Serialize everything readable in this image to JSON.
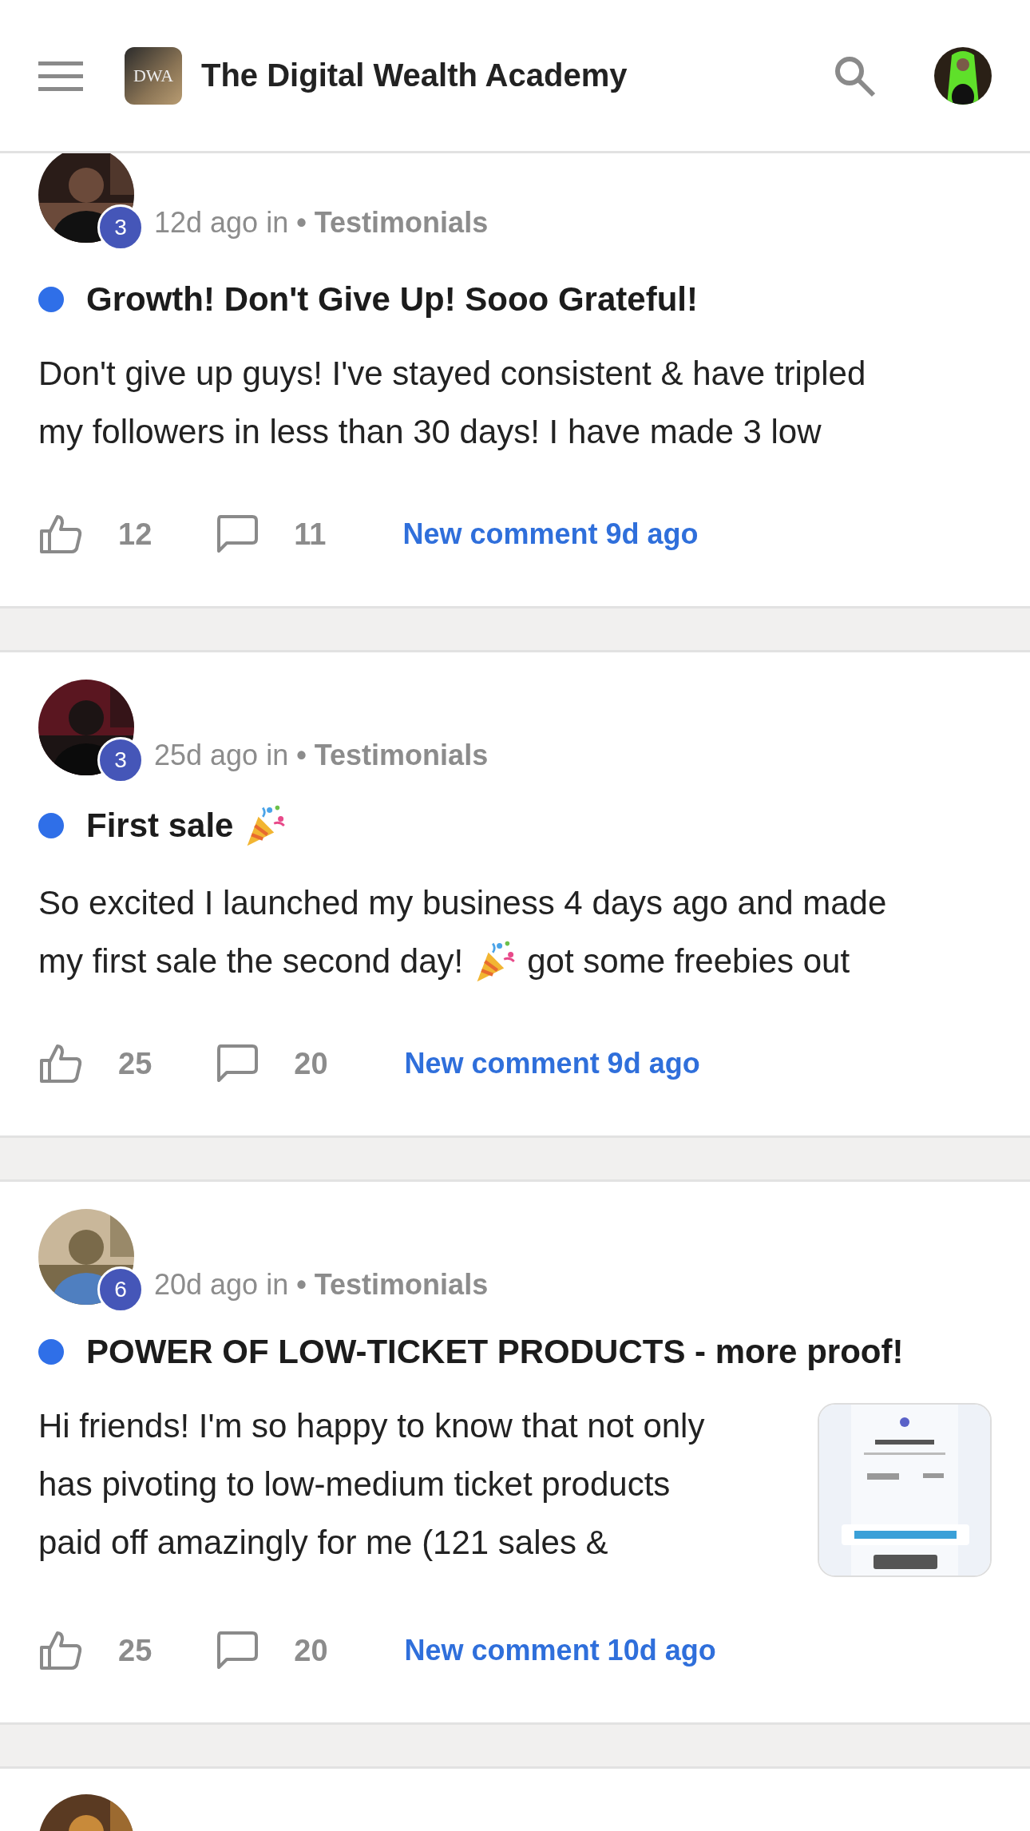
{
  "header": {
    "logo_text": "DWA",
    "title": "The Digital Wealth Academy"
  },
  "posts": [
    {
      "level": "3",
      "time": "12d ago in",
      "category": "• Testimonials",
      "unread": true,
      "title": "Growth! Don't Give Up! Sooo Grateful!",
      "lines": [
        [
          {
            "kind": "text",
            "text": "Don't give up guys! I've stayed consistent & have tripled"
          }
        ],
        [
          {
            "kind": "text",
            "text": "my followers in less than 30 days! I have made 3 low"
          }
        ]
      ],
      "likes": "12",
      "comments": "11",
      "activity": "New comment 9d ago"
    },
    {
      "level": "3",
      "time": "25d ago in",
      "category": "• Testimonials",
      "unread": true,
      "title": "First sale",
      "title_extra": {
        "kind": "emoji"
      },
      "lines": [
        [
          {
            "kind": "text",
            "text": "So excited I launched my business 4 days ago and made"
          }
        ],
        [
          {
            "kind": "text",
            "text": "my first sale the second day!"
          },
          {
            "kind": "emoji"
          },
          {
            "kind": "text",
            "text": "got some freebies out"
          }
        ]
      ],
      "likes": "25",
      "comments": "20",
      "activity": "New comment 9d ago"
    },
    {
      "level": "6",
      "time": "20d ago in",
      "category": "• Testimonials",
      "unread": true,
      "title": "POWER OF LOW-TICKET PRODUCTS - more proof!",
      "lines": [
        [
          {
            "kind": "text",
            "text": "Hi friends! I'm so happy to know that not only"
          }
        ],
        [
          {
            "kind": "text",
            "text": "has pivoting to low-medium ticket products"
          }
        ],
        [
          {
            "kind": "text",
            "text": "paid off amazingly for me (121 sales &"
          }
        ]
      ],
      "attachment": {
        "kind": "picture"
      },
      "likes": "25",
      "comments": "20",
      "activity": "New comment 10d ago"
    }
  ],
  "next_post": {
    "kind": "picture"
  }
}
